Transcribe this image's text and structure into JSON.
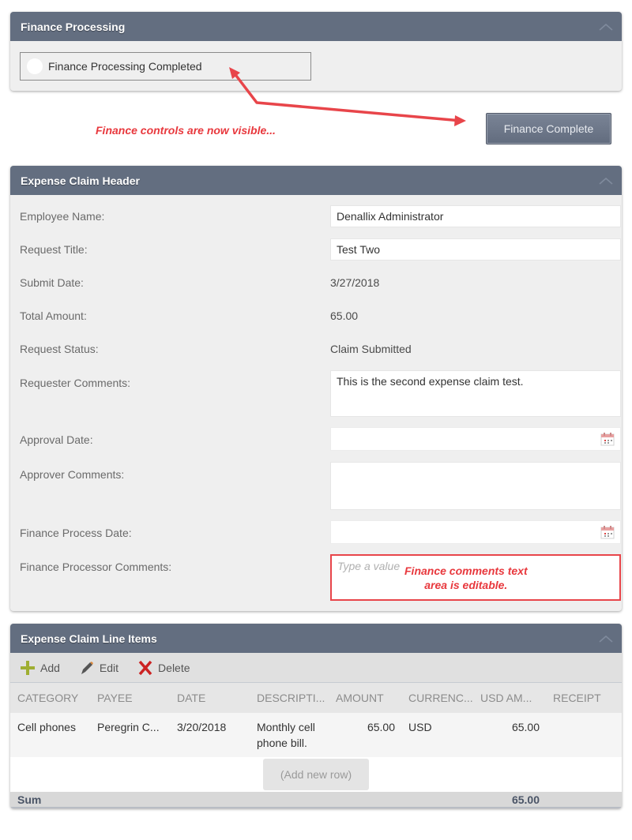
{
  "finance_panel": {
    "title": "Finance Processing",
    "checkbox_label": "Finance Processing Completed",
    "checked": false
  },
  "annotations": {
    "controls_visible": "Finance controls are now visible...",
    "comments_editable_line1": "Finance comments text",
    "comments_editable_line2": "area is editable.",
    "color": "#e8383d"
  },
  "finance_button": {
    "label": "Finance Complete"
  },
  "header_panel": {
    "title": "Expense Claim Header",
    "fields": {
      "employee_name": {
        "label": "Employee Name:",
        "value": "Denallix Administrator"
      },
      "request_title": {
        "label": "Request Title:",
        "value": "Test Two"
      },
      "submit_date": {
        "label": "Submit Date:",
        "value": "3/27/2018"
      },
      "total_amount": {
        "label": "Total Amount:",
        "value": "65.00"
      },
      "request_status": {
        "label": "Request Status:",
        "value": "Claim Submitted"
      },
      "requester_comments": {
        "label": "Requester Comments:",
        "value": "This is the second expense claim test."
      },
      "approval_date": {
        "label": "Approval Date:",
        "value": ""
      },
      "approver_comments": {
        "label": "Approver Comments:",
        "value": ""
      },
      "finance_process_date": {
        "label": "Finance Process Date:",
        "value": ""
      },
      "finance_processor_comments": {
        "label": "Finance Processor Comments:",
        "value": "",
        "placeholder": "Type a value"
      }
    }
  },
  "line_items_panel": {
    "title": "Expense Claim Line Items",
    "toolbar": {
      "add": "Add",
      "edit": "Edit",
      "delete": "Delete"
    },
    "columns": [
      "CATEGORY",
      "PAYEE",
      "DATE",
      "DESCRIPTI...",
      "AMOUNT",
      "CURRENC...",
      "USD AM...",
      "RECEIPT"
    ],
    "rows": [
      {
        "category": "Cell phones",
        "payee": "Peregrin C...",
        "date": "3/20/2018",
        "description": "Monthly cell phone bill.",
        "amount": "65.00",
        "currency": "USD",
        "usd_amount": "65.00",
        "receipt": ""
      }
    ],
    "add_row_label": "(Add new row)",
    "sum_label": "Sum",
    "sum_value": "65.00"
  }
}
